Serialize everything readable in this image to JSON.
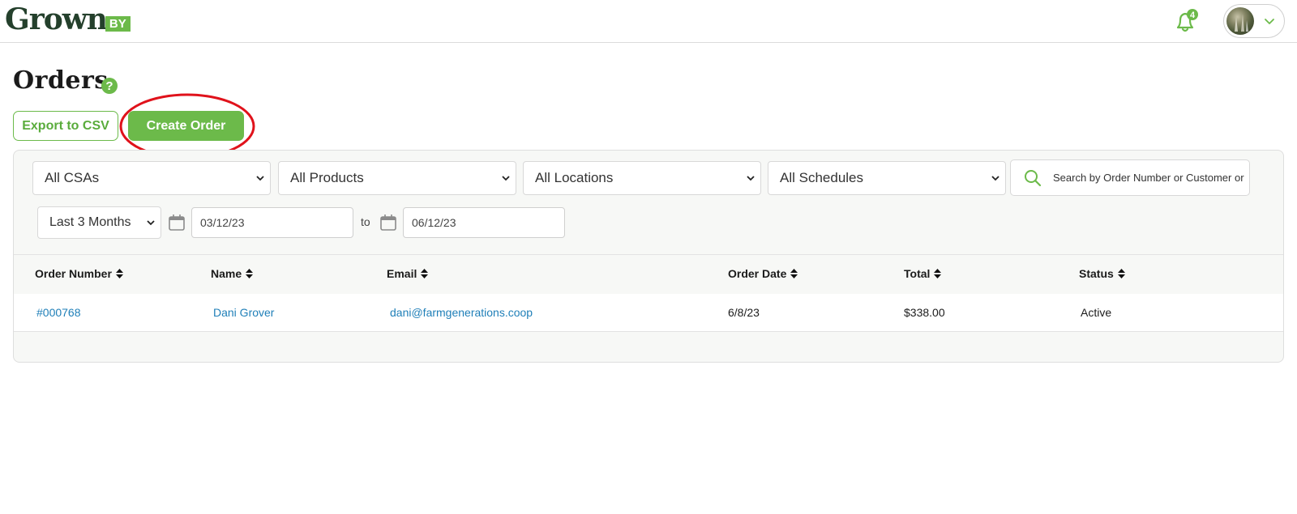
{
  "header": {
    "logo_word": "Grown",
    "logo_suffix": "BY",
    "notification_count": "4",
    "icons": {
      "bell": "bell-icon",
      "avatar": "user-avatar",
      "chevron": "chevron-down-icon"
    },
    "brand_color": "#6cba4a"
  },
  "page": {
    "title": "Orders",
    "help_icon": "question-circle-icon"
  },
  "actions": {
    "export_label": "Export to CSV",
    "create_label": "Create Order",
    "annotation_color": "#e0121b"
  },
  "filters": {
    "csa": "All CSAs",
    "products": "All Products",
    "locations": "All Locations",
    "schedules": "All Schedules",
    "search_placeholder": "Search by Order Number or Customer or",
    "range": "Last 3 Months",
    "date_from": "03/12/23",
    "date_to_label": "to",
    "date_to": "06/12/23"
  },
  "table": {
    "columns": [
      "Order Number",
      "Name",
      "Email",
      "Order Date",
      "Total",
      "Status"
    ],
    "rows": [
      {
        "order_number": "#000768",
        "name": "Dani Grover",
        "email": "dani@farmgenerations.coop",
        "order_date": "6/8/23",
        "total": "$338.00",
        "status": "Active"
      }
    ]
  }
}
